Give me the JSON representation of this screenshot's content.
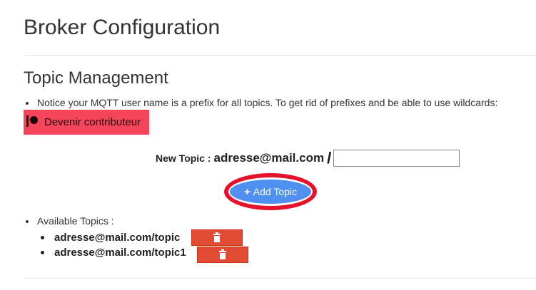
{
  "page": {
    "title": "Broker Configuration"
  },
  "topic_management": {
    "heading": "Topic Management",
    "notice": "Notice your MQTT user name is a prefix for all topics. To get rid of prefixes and be able to use wildcards:",
    "contribute_button": {
      "label": "Devenir contributeur",
      "icon": "patreon-icon",
      "color": "#f4455b"
    },
    "new_topic": {
      "label": "New Topic :",
      "prefix": "adresse@mail.com",
      "separator": "/",
      "input_value": "",
      "input_placeholder": ""
    },
    "add_button": {
      "label": "Add Topic",
      "icon": "plus-icon",
      "color": "#4f8ff0",
      "highlight_color": "#e5122b"
    },
    "available_label": "Available Topics :",
    "topics": [
      {
        "name": "adresse@mail.com/topic",
        "delete_icon": "trash-icon"
      },
      {
        "name": "adresse@mail.com/topic1",
        "delete_icon": "trash-icon"
      }
    ],
    "delete_color": "#e14b33"
  }
}
